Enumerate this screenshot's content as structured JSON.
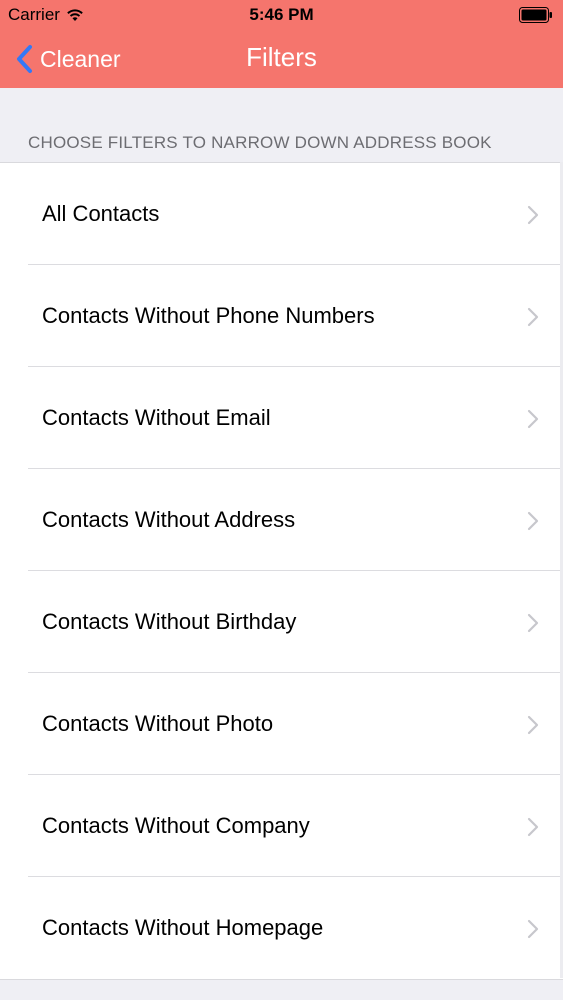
{
  "status_bar": {
    "carrier": "Carrier",
    "time": "5:46 PM",
    "wifi_icon": "wifi-icon",
    "battery_icon": "battery-icon"
  },
  "nav": {
    "back_label": "Cleaner",
    "title": "Filters",
    "background_color": "#f5756d",
    "tint_color": "#3478f6"
  },
  "section_header": "CHOOSE FILTERS TO NARROW DOWN ADDRESS BOOK",
  "filters": [
    {
      "label": "All Contacts",
      "name": "filter-all-contacts"
    },
    {
      "label": "Contacts Without Phone Numbers",
      "name": "filter-without-phone-numbers"
    },
    {
      "label": "Contacts Without Email",
      "name": "filter-without-email"
    },
    {
      "label": "Contacts Without Address",
      "name": "filter-without-address"
    },
    {
      "label": "Contacts Without Birthday",
      "name": "filter-without-birthday"
    },
    {
      "label": "Contacts Without Photo",
      "name": "filter-without-photo"
    },
    {
      "label": "Contacts Without Company",
      "name": "filter-without-company"
    },
    {
      "label": "Contacts Without Homepage",
      "name": "filter-without-homepage"
    }
  ]
}
